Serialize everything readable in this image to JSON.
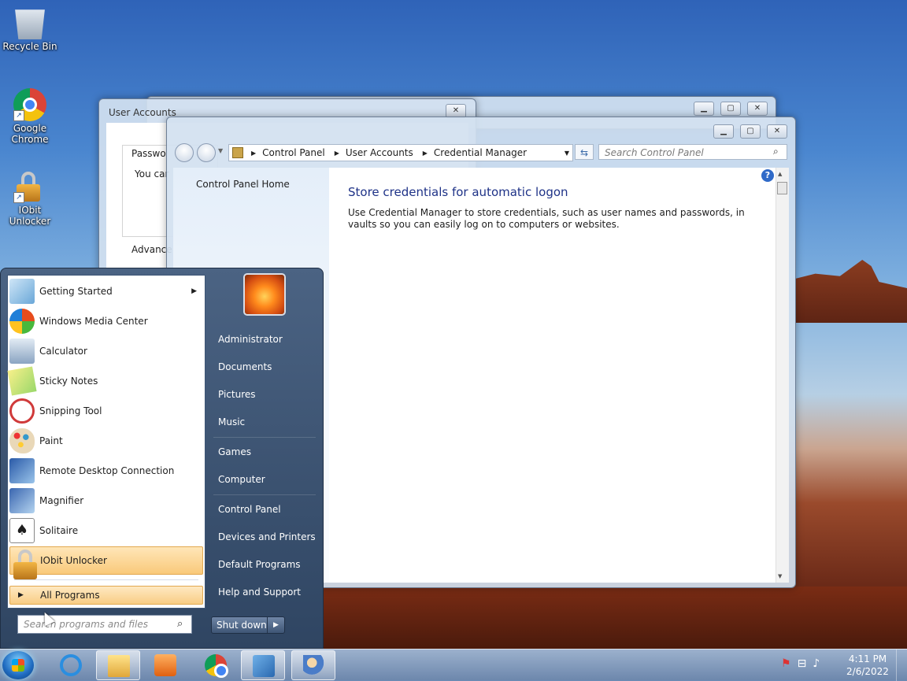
{
  "desktop": {
    "icons": [
      {
        "label": "Recycle Bin",
        "icon": "recycle-bin-icon"
      },
      {
        "label": "Google Chrome",
        "icon": "chrome-icon"
      },
      {
        "label": "IObit Unlocker",
        "icon": "iobit-unlocker-icon"
      }
    ]
  },
  "user_accounts_window": {
    "title": "User Accounts",
    "tab": "Passwo",
    "body_text": "You car",
    "advanced": "Advance",
    "close_label": "✕"
  },
  "credential_manager": {
    "breadcrumb": [
      "Control Panel",
      "User Accounts",
      "Credential Manager"
    ],
    "search_placeholder": "Search Control Panel",
    "sidebar_link": "Control Panel Home",
    "heading": "Store credentials for automatic logon",
    "description": "Use Credential Manager to store credentials, such as user names and passwords, in vaults so you can easily log on to computers or websites.",
    "help": "?"
  },
  "start_menu": {
    "programs": [
      {
        "label": "Getting Started",
        "icon": "getting-started-icon",
        "has_submenu": true
      },
      {
        "label": "Windows Media Center",
        "icon": "media-center-icon"
      },
      {
        "label": "Calculator",
        "icon": "calculator-icon"
      },
      {
        "label": "Sticky Notes",
        "icon": "sticky-notes-icon"
      },
      {
        "label": "Snipping Tool",
        "icon": "snipping-tool-icon"
      },
      {
        "label": "Paint",
        "icon": "paint-icon"
      },
      {
        "label": "Remote Desktop Connection",
        "icon": "remote-desktop-icon"
      },
      {
        "label": "Magnifier",
        "icon": "magnifier-icon"
      },
      {
        "label": "Solitaire",
        "icon": "solitaire-icon"
      },
      {
        "label": "IObit Unlocker",
        "icon": "iobit-unlocker-icon",
        "highlighted": true
      }
    ],
    "all_programs": "All Programs",
    "search_placeholder": "Search programs and files",
    "right": {
      "user": "Administrator",
      "documents": "Documents",
      "pictures": "Pictures",
      "music": "Music",
      "games": "Games",
      "computer": "Computer",
      "control_panel": "Control Panel",
      "devices": "Devices and Printers",
      "default_programs": "Default Programs",
      "help": "Help and Support"
    },
    "shutdown": "Shut down"
  },
  "taskbar": {
    "time": "4:11 PM",
    "date": "2/6/2022"
  }
}
